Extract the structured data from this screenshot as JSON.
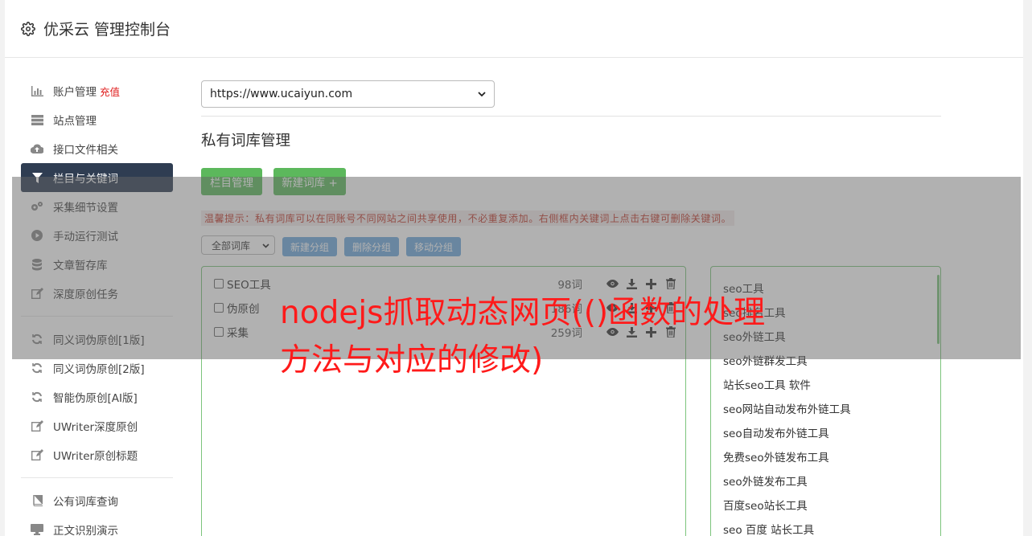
{
  "header": {
    "title": "优采云 管理控制台",
    "icon": "gear-icon"
  },
  "sidebar": {
    "items": [
      {
        "label": "账户管理",
        "icon": "bar-chart-icon",
        "extra": "充值"
      },
      {
        "label": "站点管理",
        "icon": "server-icon"
      },
      {
        "label": "接口文件相关",
        "icon": "cloud-upload-icon"
      },
      {
        "label": "栏目与关键词",
        "icon": "filter-icon",
        "active": true
      },
      {
        "label": "采集细节设置",
        "icon": "gears-icon"
      },
      {
        "label": "手动运行测试",
        "icon": "play-circle-icon"
      },
      {
        "label": "文章暂存库",
        "icon": "database-icon"
      },
      {
        "label": "深度原创任务",
        "icon": "edit-icon"
      },
      {
        "label": "同义词伪原创[1版]",
        "icon": "refresh-icon"
      },
      {
        "label": "同义词伪原创[2版]",
        "icon": "refresh-icon"
      },
      {
        "label": "智能伪原创[AI版]",
        "icon": "refresh-icon"
      },
      {
        "label": "UWriter深度原创",
        "icon": "edit-icon"
      },
      {
        "label": "UWriter原创标题",
        "icon": "edit-icon"
      },
      {
        "label": "公有词库查询",
        "icon": "book-icon"
      },
      {
        "label": "正文识别演示",
        "icon": "monitor-icon"
      }
    ]
  },
  "main": {
    "site_select": "https://www.ucaiyun.com",
    "section_title": "私有词库管理",
    "buttons": {
      "column_manage": "栏目管理",
      "new_library": "新建词库 +"
    },
    "hint": "温馨提示：私有词库可以在同账号不同网站之间共享使用，不必重复添加。右侧框内关键词上点击右键可删除关键词。",
    "library_filter": "全部词库",
    "group_buttons": {
      "new": "新建分组",
      "delete": "删除分组",
      "move": "移动分组"
    },
    "groups": [
      {
        "name": "SEO工具",
        "count": "98词"
      },
      {
        "name": "伪原创",
        "count": "186词"
      },
      {
        "name": "采集",
        "count": "259词"
      }
    ],
    "keywords": [
      "seo工具",
      "seo排名工具",
      "seo外链工具",
      "seo外链群发工具",
      "站长seo工具 软件",
      "seo网站自动发布外链工具",
      "seo自动发布外链工具",
      "免费seo外链发布工具",
      "seo外链发布工具",
      "百度seo站长工具",
      "seo 百度 站长工具"
    ]
  },
  "overlay_text": "nodejs抓取动态网页(()函数的处理方法与对应的修改)",
  "colors": {
    "active_nav": "#2f3d52",
    "green": "#5cb85c",
    "blue": "#6fa8dc",
    "red_text": "#ff1a1a"
  }
}
